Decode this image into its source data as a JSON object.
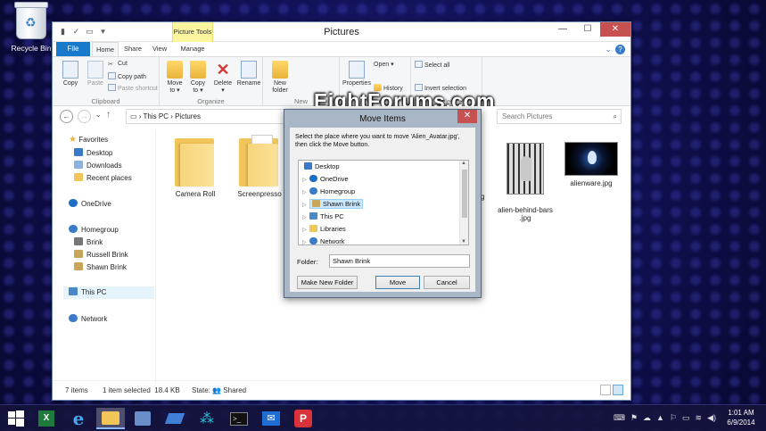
{
  "desktop": {
    "recycle_bin_label": "Recycle Bin"
  },
  "window": {
    "title": "Pictures",
    "contextual_tab_group": "Picture Tools",
    "tabs": {
      "file": "File",
      "home": "Home",
      "share": "Share",
      "view": "View",
      "manage": "Manage"
    }
  },
  "ribbon": {
    "clipboard": {
      "label": "Clipboard",
      "copy": "Copy",
      "paste": "Paste",
      "cut": "Cut",
      "copy_path": "Copy path",
      "paste_shortcut": "Paste shortcut"
    },
    "organize": {
      "label": "Organize",
      "move_to": [
        "Move",
        "to ▾"
      ],
      "copy_to": [
        "Copy",
        "to ▾"
      ],
      "delete": [
        "Delete",
        "▾"
      ],
      "rename": "Rename"
    },
    "new": {
      "label": "New",
      "new_folder": [
        "New",
        "folder"
      ]
    },
    "open": {
      "label": "Open",
      "properties": "Properties",
      "open": "Open ▾",
      "history": "History"
    },
    "select": {
      "label": "Select",
      "select_all": "Select all",
      "invert_selection": "Invert selection"
    }
  },
  "watermark": "EightForums.com",
  "address": {
    "path_root": "This PC",
    "path_current": "Pictures",
    "search_placeholder": "Search Pictures"
  },
  "nav_pane": {
    "favorites": "Favorites",
    "desktop": "Desktop",
    "downloads": "Downloads",
    "recent_places": "Recent places",
    "onedrive": "OneDrive",
    "homegroup": "Homegroup",
    "brink": "Brink",
    "russell_brink": "Russell Brink",
    "shawn_brink": "Shawn Brink",
    "this_pc": "This PC",
    "network": "Network"
  },
  "files": [
    {
      "name": "Camera Roll"
    },
    {
      "name": "Screenpresso"
    },
    {
      "name": "alien-behind-bars\n.jpg"
    },
    {
      "name": "alienware.jpg"
    }
  ],
  "partial_label": "g",
  "status": {
    "item_count": "7 items",
    "selected": "1 item selected  18.4 KB",
    "state": "State: 👥 Shared"
  },
  "dialog": {
    "title": "Move Items",
    "message": "Select the place where you want to move 'Alien_Avatar.jpg', then click the Move button.",
    "tree": {
      "desktop": "Desktop",
      "onedrive": "OneDrive",
      "homegroup": "Homegroup",
      "shawn_brink": "Shawn Brink",
      "this_pc": "This PC",
      "libraries": "Libraries",
      "network": "Network"
    },
    "folder_label": "Folder:",
    "folder_value": "Shawn Brink",
    "make_new_folder": "Make New Folder",
    "move": "Move",
    "cancel": "Cancel"
  },
  "taskbar": {
    "time": "1:01 AM",
    "date": "6/9/2014"
  },
  "colors": {
    "accent": "#1979ca",
    "close_red": "#c75050",
    "contextual_yellow": "#fbf59d",
    "folder_yellow": "#f1c55a"
  },
  "icons": [
    "recycle-bin-icon",
    "folder-icon",
    "search-icon",
    "windows-logo-icon",
    "excel-icon",
    "internet-explorer-icon",
    "file-explorer-icon",
    "cmd-icon",
    "mail-icon",
    "screenpresso-icon"
  ]
}
